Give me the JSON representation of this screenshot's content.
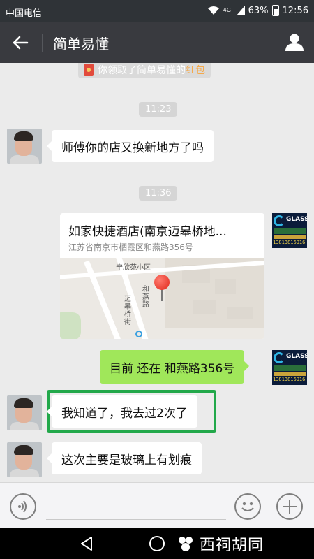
{
  "status_bar": {
    "carrier": "中国电信",
    "battery": "63%",
    "time": "12:56",
    "signal_text": "4G"
  },
  "header": {
    "title": "简单易懂"
  },
  "chat": {
    "system_notice": {
      "prefix": "你领取了简单易懂的",
      "highlight": "红包"
    },
    "time_1": "11:23",
    "msg_1": "师傅你的店又换新地方了吗",
    "time_2": "11:36",
    "location": {
      "title": "如家快捷酒店(南京迈皋桥地...",
      "address": "江苏省南京市栖霞区和燕路356号",
      "map_labels": {
        "area": "宁欣苑小区",
        "road_1": "和燕路",
        "road_2": "迈皋桥街"
      }
    },
    "msg_2": "目前  还在 和燕路356号",
    "msg_3": "我知道了，我去过2次了",
    "msg_4": "这次主要是玻璃上有划痕",
    "brand_avatar": {
      "name": "GLASS",
      "phone": "13813816916"
    }
  },
  "watermark": {
    "text": "西祠胡同"
  },
  "colors": {
    "header_bg": "#393a3f",
    "chat_bg": "#ebebeb",
    "sent_bubble": "#a0e75a",
    "highlight_border": "#22a84a",
    "red_packet": "#e24a3b"
  }
}
